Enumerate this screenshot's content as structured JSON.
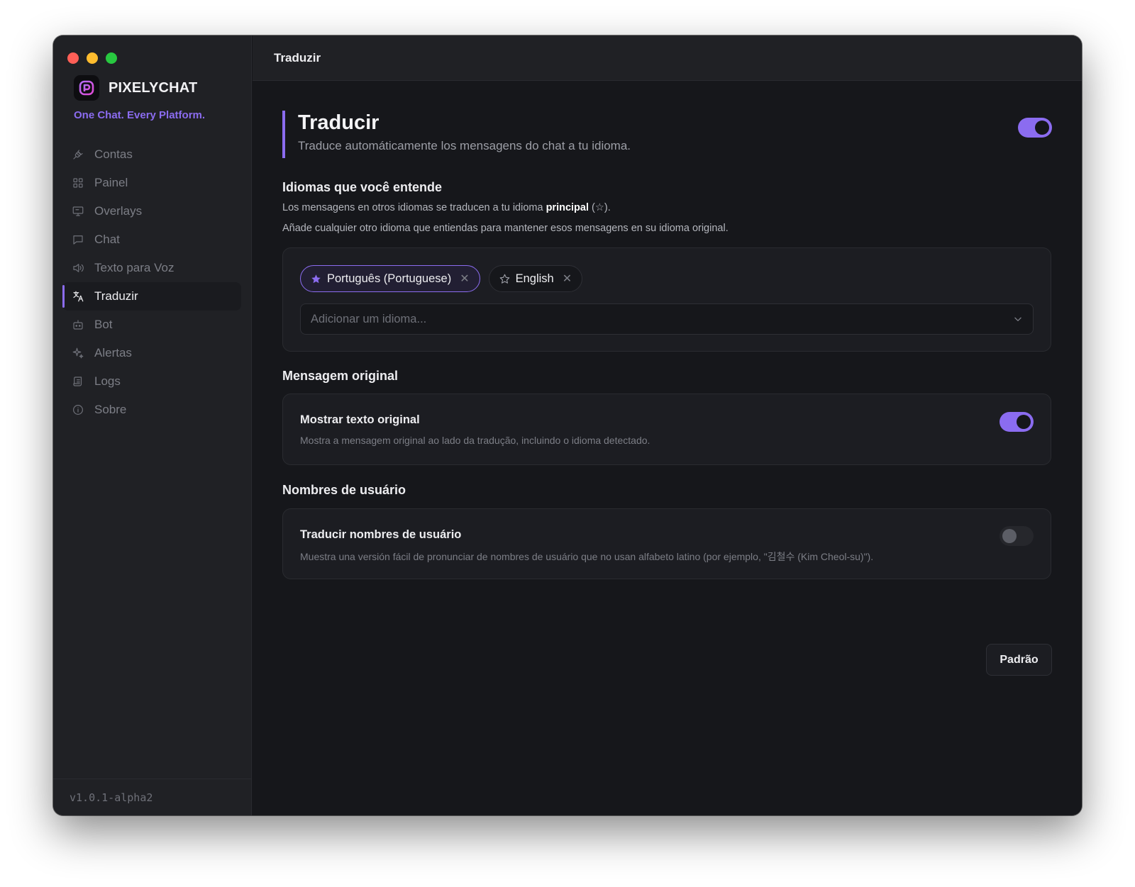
{
  "app": {
    "name": "PIXELYCHAT",
    "tagline": "One Chat. Every Platform.",
    "version": "v1.0.1-alpha2",
    "accent_color": "#8b6cf0"
  },
  "sidebar": {
    "items": [
      {
        "label": "Contas",
        "icon": "plug-icon"
      },
      {
        "label": "Painel",
        "icon": "grid-icon"
      },
      {
        "label": "Overlays",
        "icon": "monitor-icon"
      },
      {
        "label": "Chat",
        "icon": "chat-bubble-icon"
      },
      {
        "label": "Texto para Voz",
        "icon": "speaker-icon"
      },
      {
        "label": "Traduzir",
        "icon": "translate-icon",
        "active": true
      },
      {
        "label": "Bot",
        "icon": "bot-icon"
      },
      {
        "label": "Alertas",
        "icon": "sparkle-icon"
      },
      {
        "label": "Logs",
        "icon": "scroll-icon"
      },
      {
        "label": "Sobre",
        "icon": "info-icon"
      }
    ]
  },
  "header": {
    "title": "Traduzir"
  },
  "page": {
    "title": "Traducir",
    "description": "Traduce automáticamente los mensagens do chat a tu idioma.",
    "enabled": true
  },
  "languages": {
    "heading": "Idiomas que você entende",
    "text1_before": "Los mensagens en otros idiomas se traducen a tu idioma ",
    "text1_bold": "principal",
    "text1_after": " (☆).",
    "text2": "Añade cualquier otro idioma que entiendas para mantener esos mensagens en su idioma original.",
    "chips": [
      {
        "label": "Português (Portuguese)",
        "primary": true
      },
      {
        "label": "English",
        "primary": false
      }
    ],
    "remove_glyph": "✕",
    "add_placeholder": "Adicionar um idioma..."
  },
  "original": {
    "heading": "Mensagem original",
    "option_title": "Mostrar texto original",
    "option_desc": "Mostra a mensagem original ao lado da tradução, incluindo o idioma detectado.",
    "enabled": true
  },
  "usernames": {
    "heading": "Nombres de usuário",
    "option_title": "Traducir nombres de usuário",
    "option_desc": "Muestra una versión fácil de pronunciar de nombres de usuário que no usan alfabeto latino (por ejemplo, \"김철수 (Kim Cheol-su)\").",
    "enabled": false
  },
  "actions": {
    "default_label": "Padrão"
  }
}
